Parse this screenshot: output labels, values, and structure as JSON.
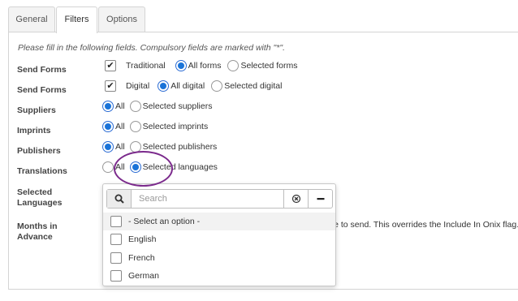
{
  "tabs": [
    {
      "label": "General"
    },
    {
      "label": "Filters"
    },
    {
      "label": "Options"
    }
  ],
  "intro": "Please fill in the following fields. Compulsory fields are marked with \"*\".",
  "rows": {
    "send_forms_traditional": {
      "label": "Send Forms",
      "checkbox_label": "Traditional",
      "options": [
        "All forms",
        "Selected forms"
      ],
      "selected": "All forms"
    },
    "send_forms_digital": {
      "label": "Send Forms",
      "checkbox_label": "Digital",
      "options": [
        "All digital",
        "Selected digital"
      ],
      "selected": "All digital"
    },
    "suppliers": {
      "label": "Suppliers",
      "options": [
        "All",
        "Selected suppliers"
      ],
      "selected": "All"
    },
    "imprints": {
      "label": "Imprints",
      "options": [
        "All",
        "Selected imprints"
      ],
      "selected": "All"
    },
    "publishers": {
      "label": "Publishers",
      "options": [
        "All",
        "Selected publishers"
      ],
      "selected": "All"
    },
    "translations": {
      "label": "Translations",
      "options": [
        "All",
        "Selected languages"
      ],
      "selected": "Selected languages"
    },
    "selected_languages": {
      "label_line1": "Selected",
      "label_line2": "Languages"
    },
    "months_in_advance": {
      "label_line1": "Months in",
      "label_line2": "Advance",
      "hint": "late to send. This overrides the Include In Onix flag."
    }
  },
  "dropdown": {
    "search_placeholder": "Search",
    "search_value": "",
    "items": [
      {
        "label": "- Select an option -",
        "checked": false
      },
      {
        "label": "English",
        "checked": false
      },
      {
        "label": "French",
        "checked": false
      },
      {
        "label": "German",
        "checked": false
      }
    ]
  },
  "colors": {
    "accent": "#1a73d8",
    "highlight_circle": "#7b2a8c"
  },
  "icons": {
    "search_button": "search-icon",
    "clear_button": "clear-circle-icon",
    "deselect_button": "minus-icon",
    "checkbox_checked": "checkmark-icon"
  }
}
